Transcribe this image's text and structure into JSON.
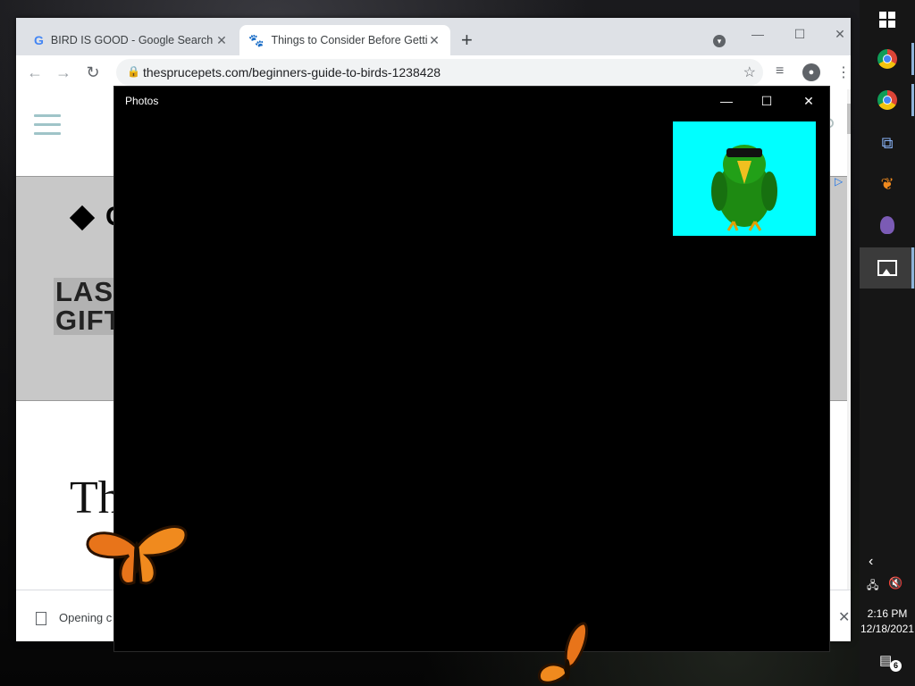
{
  "chrome": {
    "tabs": [
      {
        "title": "BIRD IS GOOD - Google Search",
        "icon": "google-icon"
      },
      {
        "title": "Things to Consider Before Gettin",
        "icon": "paw-icon",
        "active": true
      }
    ],
    "new_tab": "+",
    "url": "thesprucepets.com/beginners-guide-to-birds-1238428",
    "page": {
      "ad_brand": "C",
      "ad_line1": "LAS",
      "ad_line2": "GIFT",
      "headline": "Th"
    },
    "download_bar": {
      "text": "Opening c"
    }
  },
  "photos": {
    "title": "Photos",
    "thumbnail_bg": "#00ffff"
  },
  "taskbar": {
    "items": [
      "windows-start",
      "chrome",
      "chrome",
      "remote-desktop",
      "butterfly-app",
      "bonzi-app",
      "photos"
    ],
    "time": "2:16 PM",
    "date": "12/18/2021",
    "notifications": "6"
  }
}
